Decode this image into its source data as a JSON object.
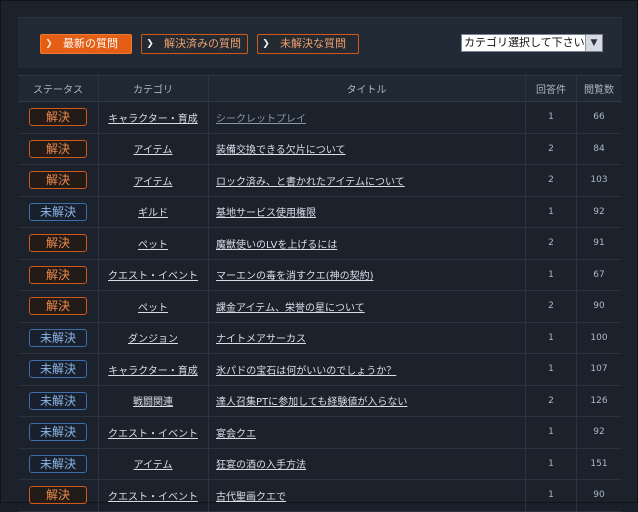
{
  "filters": {
    "latest": "最新の質問",
    "solved": "解決済みの質問",
    "unsolved": "未解決な質問"
  },
  "category_select": {
    "selected": "カテゴリ選択して下さい"
  },
  "columns": {
    "status": "ステータス",
    "category": "カテゴリ",
    "title": "タイトル",
    "answers": "回答件",
    "views": "閲覧数"
  },
  "rows": [
    {
      "status": "解決",
      "category": "キャラクター・育成",
      "title": "シークレットプレイ",
      "answers": "1",
      "views": "66"
    },
    {
      "status": "解決",
      "category": "アイテム",
      "title": "装備交換できる欠片について",
      "answers": "2",
      "views": "84"
    },
    {
      "status": "解決",
      "category": "アイテム",
      "title": "ロック済み、と書かれたアイテムについて",
      "answers": "2",
      "views": "103"
    },
    {
      "status": "未解決",
      "category": "ギルド",
      "title": "基地サービス使用権限",
      "answers": "1",
      "views": "92"
    },
    {
      "status": "解決",
      "category": "ペット",
      "title": "魔獣使いのLVを上げるには",
      "answers": "2",
      "views": "91"
    },
    {
      "status": "解決",
      "category": "クエスト・イベント",
      "title": "マーエンの毒を消すクエ(神の契約)",
      "answers": "1",
      "views": "67"
    },
    {
      "status": "解決",
      "category": "ペット",
      "title": "課金アイテム、栄誉の星について",
      "answers": "2",
      "views": "90"
    },
    {
      "status": "未解決",
      "category": "ダンジョン",
      "title": "ナイトメアサーカス",
      "answers": "1",
      "views": "100"
    },
    {
      "status": "未解決",
      "category": "キャラクター・育成",
      "title": "氷パドの宝石は何がいいのでしょうか？",
      "answers": "1",
      "views": "107"
    },
    {
      "status": "未解決",
      "category": "戦闘関連",
      "title": "達人召集PTに参加しても経験値が入らない",
      "answers": "2",
      "views": "126"
    },
    {
      "status": "未解決",
      "category": "クエスト・イベント",
      "title": "宴会クエ",
      "answers": "1",
      "views": "92"
    },
    {
      "status": "未解決",
      "category": "アイテム",
      "title": "狂宴の酒の入手方法",
      "answers": "1",
      "views": "151"
    },
    {
      "status": "解決",
      "category": "クエスト・イベント",
      "title": "古代聖画クエで",
      "answers": "1",
      "views": "90"
    }
  ],
  "colors": {
    "accent": "#e45e14",
    "solved": "#d2571b",
    "unsolved": "#3c6ea8",
    "background": "#1b222c"
  }
}
